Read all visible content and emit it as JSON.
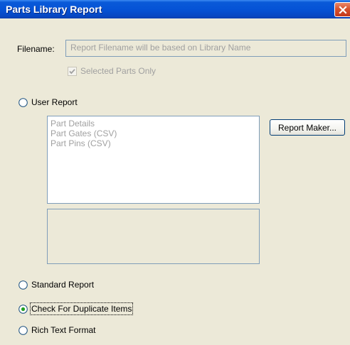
{
  "window": {
    "title": "Parts Library Report"
  },
  "filename": {
    "label": "Filename:",
    "placeholder": "Report Filename will be based on Library Name"
  },
  "selected_parts_only": {
    "label": "Selected Parts Only",
    "checked": true,
    "enabled": false
  },
  "report_types": [
    {
      "label": "User Report",
      "selected": false
    },
    {
      "label": "Standard Report",
      "selected": false
    },
    {
      "label": "Check For Duplicate Items",
      "selected": true
    },
    {
      "label": "Rich Text Format",
      "selected": false
    }
  ],
  "user_reports": [
    "Part Details",
    "Part Gates (CSV)",
    "Part Pins (CSV)"
  ],
  "report_maker_button": {
    "label": "Report Maker..."
  },
  "colors": {
    "title_bar": "#0553d6",
    "close_button": "#d7522e",
    "dialog_bg": "#ece9d8",
    "disabled_text": "#a0a0a0"
  }
}
